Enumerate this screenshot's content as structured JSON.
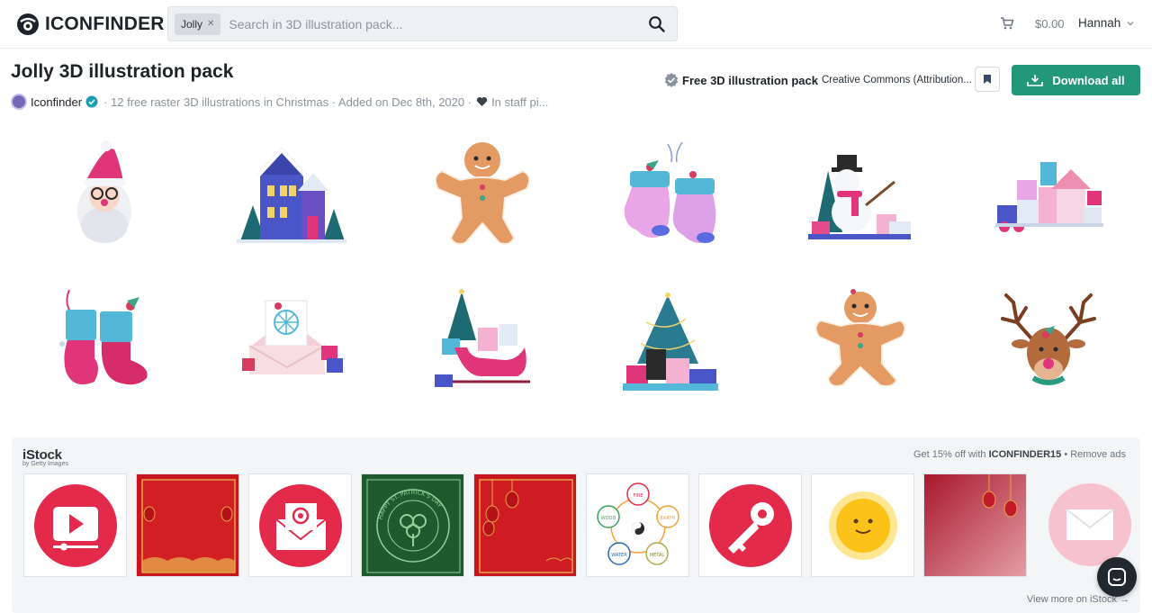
{
  "header": {
    "logo_text": "ICONFINDER",
    "search_chip": "Jolly",
    "search_placeholder": "Search in 3D illustration pack...",
    "cart_total": "$0.00",
    "user_name": "Hannah"
  },
  "pack": {
    "title": "Jolly 3D illustration pack",
    "author": "Iconfinder",
    "meta_text": "· 12 free raster 3D illustrations in Christmas · Added on Dec 8th, 2020 ·",
    "staff_pick": "In staff pi...",
    "license_name": "Free 3D illustration pack",
    "license_type": "Creative Commons (Attribution...",
    "download_label": "Download all"
  },
  "illustrations": [
    "santa-claus",
    "snowy-house",
    "gingerbread-man",
    "mittens",
    "snowman-with-gifts",
    "toy-blocks",
    "christmas-stockings",
    "christmas-letter",
    "sleigh-with-tree",
    "christmas-tree-with-gifts",
    "gingerbread-man-2",
    "reindeer"
  ],
  "istock": {
    "brand": "iStock",
    "brand_sub": "by Getty Images",
    "promo_prefix": "Get 15% off with",
    "promo_code": "ICONFINDER15",
    "promo_suffix": "• Remove ads",
    "view_more": "View more on iStock →",
    "thumbs": [
      "video-play",
      "red-lantern-frame",
      "email-at",
      "st-patricks-day",
      "red-lantern-frame-2",
      "five-elements",
      "key",
      "sun",
      "red-lantern-gradient",
      "envelope"
    ],
    "st_patrick_text": "HAPPY ST. PATRICK'S DAY",
    "elements": [
      "FIRE",
      "EARTH",
      "METAL",
      "WATER",
      "WOOD"
    ]
  },
  "colors": {
    "accent": "#23977a",
    "verified": "#1a9fb0",
    "istock_red": "#e42a4b"
  }
}
